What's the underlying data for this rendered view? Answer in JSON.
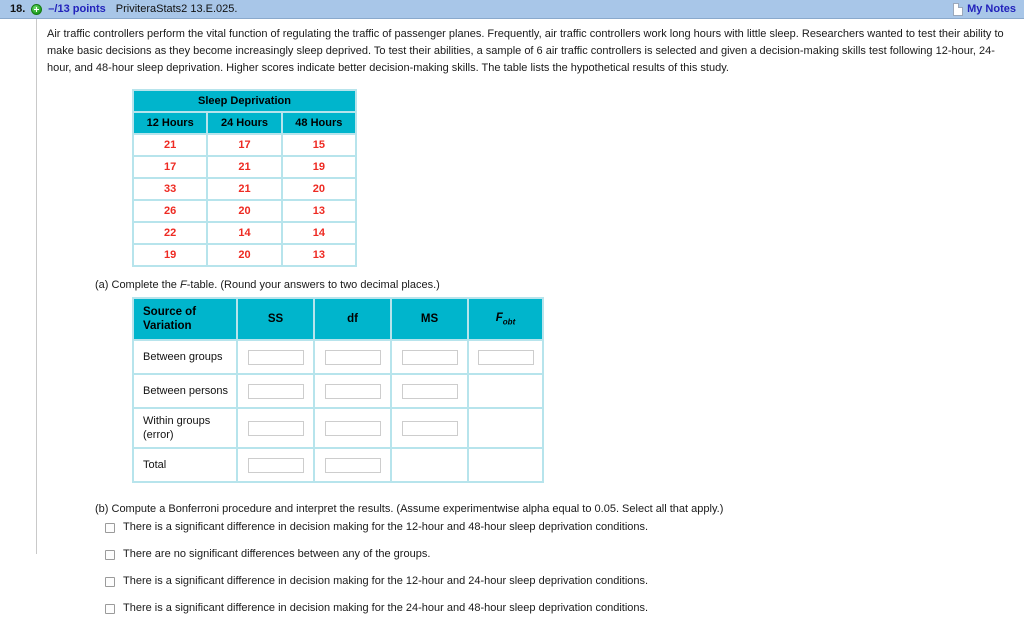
{
  "header": {
    "question_number": "18.",
    "expand_icon": "plus-circle-icon",
    "points": "–/13 points",
    "reference": "PriviteraStats2 13.E.025.",
    "notes_icon": "note-page-icon",
    "notes_label": "My Notes"
  },
  "prompt": "Air traffic controllers perform the vital function of regulating the traffic of passenger planes. Frequently, air traffic controllers work long hours with little sleep. Researchers wanted to test their ability to make basic decisions as they become increasingly sleep deprived. To test their abilities, a sample of 6 air traffic controllers is selected and given a decision-making skills test following 12-hour, 24-hour, and 48-hour sleep deprivation. Higher scores indicate better decision-making skills. The table lists the hypothetical results of this study.",
  "data_table": {
    "title": "Sleep Deprivation",
    "columns": [
      "12 Hours",
      "24 Hours",
      "48 Hours"
    ],
    "rows": [
      [
        "21",
        "17",
        "15"
      ],
      [
        "17",
        "21",
        "19"
      ],
      [
        "33",
        "21",
        "20"
      ],
      [
        "26",
        "20",
        "13"
      ],
      [
        "22",
        "14",
        "14"
      ],
      [
        "19",
        "20",
        "13"
      ]
    ]
  },
  "part_a": {
    "label_prefix": "(a) Complete the ",
    "label_italic": "F",
    "label_suffix": "-table. (Round your answers to two decimal places.)",
    "columns": [
      "Source of Variation",
      "SS",
      "df",
      "MS",
      "Fobt"
    ],
    "col_f_base": "F",
    "col_f_sub": "obt",
    "rows": [
      {
        "label": "Between groups",
        "inputs": [
          "",
          "",
          "",
          ""
        ]
      },
      {
        "label": "Between persons",
        "inputs": [
          "",
          "",
          "",
          null
        ]
      },
      {
        "label": "Within groups (error)",
        "inputs": [
          "",
          "",
          "",
          null
        ]
      },
      {
        "label": "Total",
        "inputs": [
          "",
          "",
          null,
          null
        ]
      }
    ]
  },
  "part_b": {
    "label": "(b) Compute a Bonferroni procedure and interpret the results. (Assume experimentwise alpha equal to 0.05. Select all that apply.)",
    "options": [
      "There is a significant difference in decision making for the 12-hour and 48-hour sleep deprivation conditions.",
      "There are no significant differences between any of the groups.",
      "There is a significant difference in decision making for the 12-hour and 24-hour sleep deprivation conditions.",
      "There is a significant difference in decision making for the 24-hour and 48-hour sleep deprivation conditions."
    ]
  },
  "colors": {
    "header_bar": "#a8c6e8",
    "table_header_teal": "#00b5cc",
    "table_border_teal": "#b7e4ec",
    "data_value_red": "#ee2a22",
    "link_blue": "#2222bb"
  }
}
